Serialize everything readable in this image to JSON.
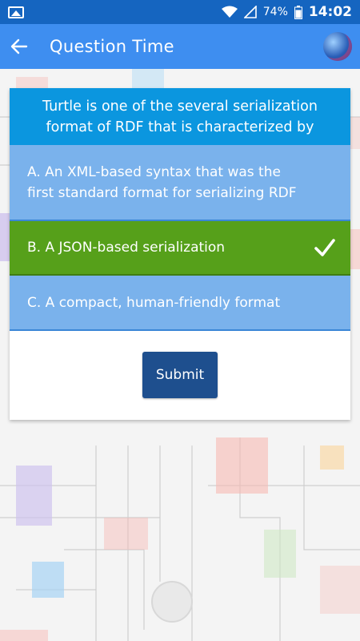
{
  "status_bar": {
    "battery": "74%",
    "time": "14:02"
  },
  "app_bar": {
    "title": "Question Time"
  },
  "quiz": {
    "question": "Turtle is one of the several serialization format of RDF that is characterized by",
    "options": [
      {
        "label": "A. An XML-based syntax that was the first standard format for serializing RDF",
        "selected": false
      },
      {
        "label": "B. A JSON-based serialization",
        "selected": true
      },
      {
        "label": "C. A compact, human-friendly format",
        "selected": false
      }
    ],
    "submit_label": "Submit"
  },
  "colors": {
    "status_bar": "#1565c0",
    "app_bar": "#3e8ef0",
    "question_bg": "#0b96df",
    "option_bg": "#7ab2ec",
    "selected_bg": "#56a01a",
    "submit_bg": "#1e4f8e"
  },
  "icons": [
    "image-icon",
    "wifi-icon",
    "signal-icon",
    "battery-icon",
    "back-arrow-icon",
    "globe-icon",
    "checkmark-icon"
  ]
}
